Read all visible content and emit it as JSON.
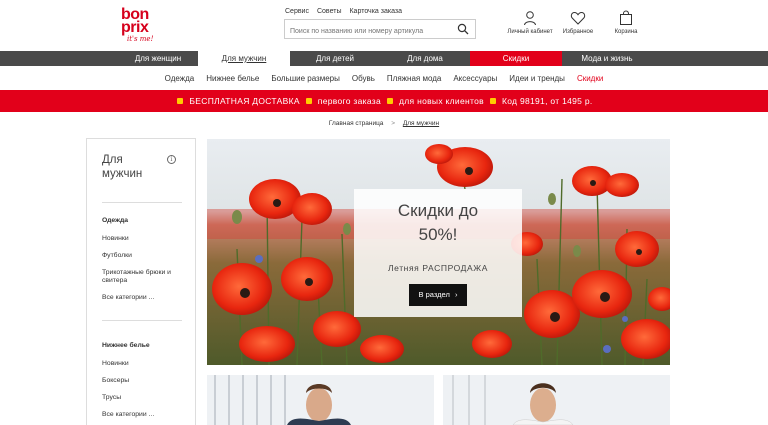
{
  "brand": {
    "line1": "bon",
    "line2": "prix",
    "tagline": "it's me!",
    "color": "#d6001c"
  },
  "top_links": [
    "Сервис",
    "Советы",
    "Карточка заказа"
  ],
  "search": {
    "placeholder": "Поиск по названию или номеру артикула",
    "value": ""
  },
  "header_icons": [
    {
      "icon": "user-icon",
      "label": "Личный кабинет"
    },
    {
      "icon": "heart-icon",
      "label": "Избранное"
    },
    {
      "icon": "bag-icon",
      "label": "Корзина"
    }
  ],
  "main_nav": {
    "women": "Для женщин",
    "men": "Для мужчин",
    "kids": "Для детей",
    "home": "Для дома",
    "sale": "Скидки",
    "lifestyle": "Мода и жизнь",
    "active": "men"
  },
  "sub_nav": [
    "Одежда",
    "Нижнее белье",
    "Большие размеры",
    "Обувь",
    "Пляжная мода",
    "Аксессуары",
    "Идеи и тренды",
    "Скидки"
  ],
  "promo": {
    "free_shipping": "БЕСПЛАТНАЯ ДОСТАВКА",
    "first_order": "первого заказа",
    "new_clients": "для новых клиентов",
    "code": "Код 98191, от 1495 р.",
    "color": "#e2001a"
  },
  "breadcrumb": {
    "home": "Главная страница",
    "current": "Для мужчин"
  },
  "sidebar": {
    "title": "Для мужчин",
    "info": "i",
    "section1": {
      "heading": "Одежда",
      "items": [
        "Новинки",
        "Футболки",
        "Трикотажные брюки и свитера",
        "Все категории ..."
      ]
    },
    "section2": {
      "heading": "Нижнее белье",
      "items": [
        "Новинки",
        "Боксеры",
        "Трусы",
        "Все категории ..."
      ]
    }
  },
  "hero": {
    "headline_line1": "Скидки до",
    "headline_line2": "50%!",
    "subline": "Летняя РАСПРОДАЖА",
    "button": "В раздел"
  }
}
